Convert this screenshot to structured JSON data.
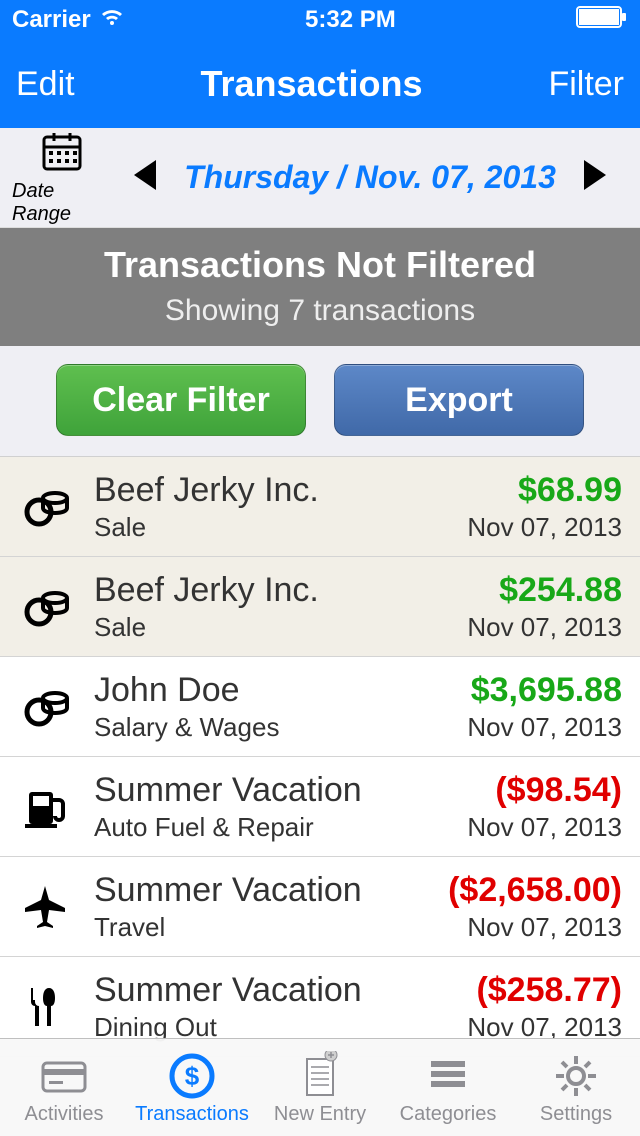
{
  "status": {
    "carrier": "Carrier",
    "time": "5:32 PM"
  },
  "nav": {
    "left": "Edit",
    "title": "Transactions",
    "right": "Filter"
  },
  "dateBar": {
    "rangeLabel": "Date Range",
    "date": "Thursday / Nov. 07, 2013"
  },
  "filterBanner": {
    "title": "Transactions Not Filtered",
    "sub": "Showing 7 transactions"
  },
  "buttons": {
    "clear": "Clear Filter",
    "export": "Export"
  },
  "transactions": [
    {
      "icon": "coins",
      "title": "Beef Jerky Inc.",
      "sub": "Sale",
      "amount": "$68.99",
      "positive": true,
      "date": "Nov 07, 2013",
      "alt": true
    },
    {
      "icon": "coins",
      "title": "Beef Jerky Inc.",
      "sub": "Sale",
      "amount": "$254.88",
      "positive": true,
      "date": "Nov 07, 2013",
      "alt": true
    },
    {
      "icon": "coins",
      "title": "John Doe",
      "sub": "Salary & Wages",
      "amount": "$3,695.88",
      "positive": true,
      "date": "Nov 07, 2013",
      "alt": false
    },
    {
      "icon": "fuel",
      "title": "Summer Vacation",
      "sub": "Auto Fuel & Repair",
      "amount": "($98.54)",
      "positive": false,
      "date": "Nov 07, 2013",
      "alt": false
    },
    {
      "icon": "plane",
      "title": "Summer Vacation",
      "sub": "Travel",
      "amount": "($2,658.00)",
      "positive": false,
      "date": "Nov 07, 2013",
      "alt": false
    },
    {
      "icon": "dining",
      "title": "Summer Vacation",
      "sub": "Dining Out",
      "amount": "($258.77)",
      "positive": false,
      "date": "Nov 07, 2013",
      "alt": false
    }
  ],
  "tabs": [
    {
      "label": "Activities",
      "icon": "card",
      "active": false
    },
    {
      "label": "Transactions",
      "icon": "dollar",
      "active": true
    },
    {
      "label": "New Entry",
      "icon": "receipt",
      "active": false
    },
    {
      "label": "Categories",
      "icon": "stack",
      "active": false
    },
    {
      "label": "Settings",
      "icon": "gear",
      "active": false
    }
  ]
}
